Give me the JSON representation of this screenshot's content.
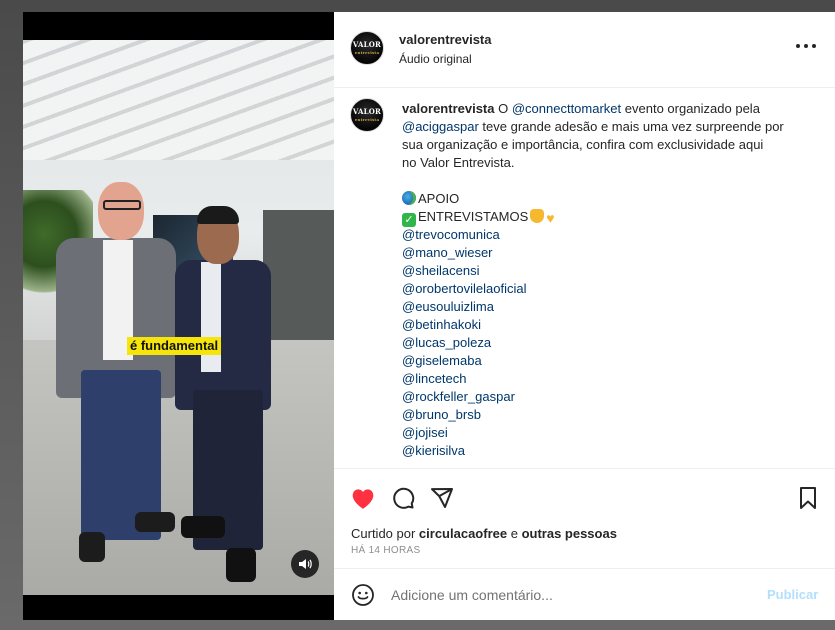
{
  "post": {
    "username": "valorentrevista",
    "audio": "Áudio original",
    "avatar_text": "VALOR",
    "avatar_sub": "entrevista"
  },
  "media": {
    "caption_overlay": "é fundamental",
    "audio_icon": "speaker-icon"
  },
  "caption": {
    "username": "valorentrevista",
    "text_1": " O ",
    "mention_1": "@connecttomarket",
    "text_2": " evento organizado pela",
    "mention_2": "@aciggaspar",
    "text_3": " teve grande adesão e mais uma vez surpreende por",
    "line_3": "sua organização e importância, confira com exclusividade aqui",
    "line_4": "no Valor Entrevista.",
    "apoio": "APOIO",
    "entrevistamos": "ENTREVISTAMOS",
    "tags": [
      "@trevocomunica",
      "@mano_wieser",
      "@sheilacensi",
      "@orobertovilelaoficial",
      "@eusouluizlima",
      "@betinhakoki",
      "@lucas_poleza",
      "@giselemaba",
      "@lincetech",
      "@rockfeller_gaspar",
      "@bruno_brsb",
      "@jojisei",
      "@kierisilva"
    ]
  },
  "actions": {
    "liked_by_prefix": "Curtido por ",
    "liked_by_user": "circulacaofree",
    "liked_by_mid": " e ",
    "liked_by_rest": "outras pessoas",
    "time": "HÁ 14 HORAS"
  },
  "comment_box": {
    "placeholder": "Adicione um comentário...",
    "publish": "Publicar"
  },
  "colors": {
    "like_red": "#ff3040",
    "mention_blue": "#00376b",
    "publish_disabled": "#b2dffc",
    "caption_yellow": "#f5e50b"
  }
}
